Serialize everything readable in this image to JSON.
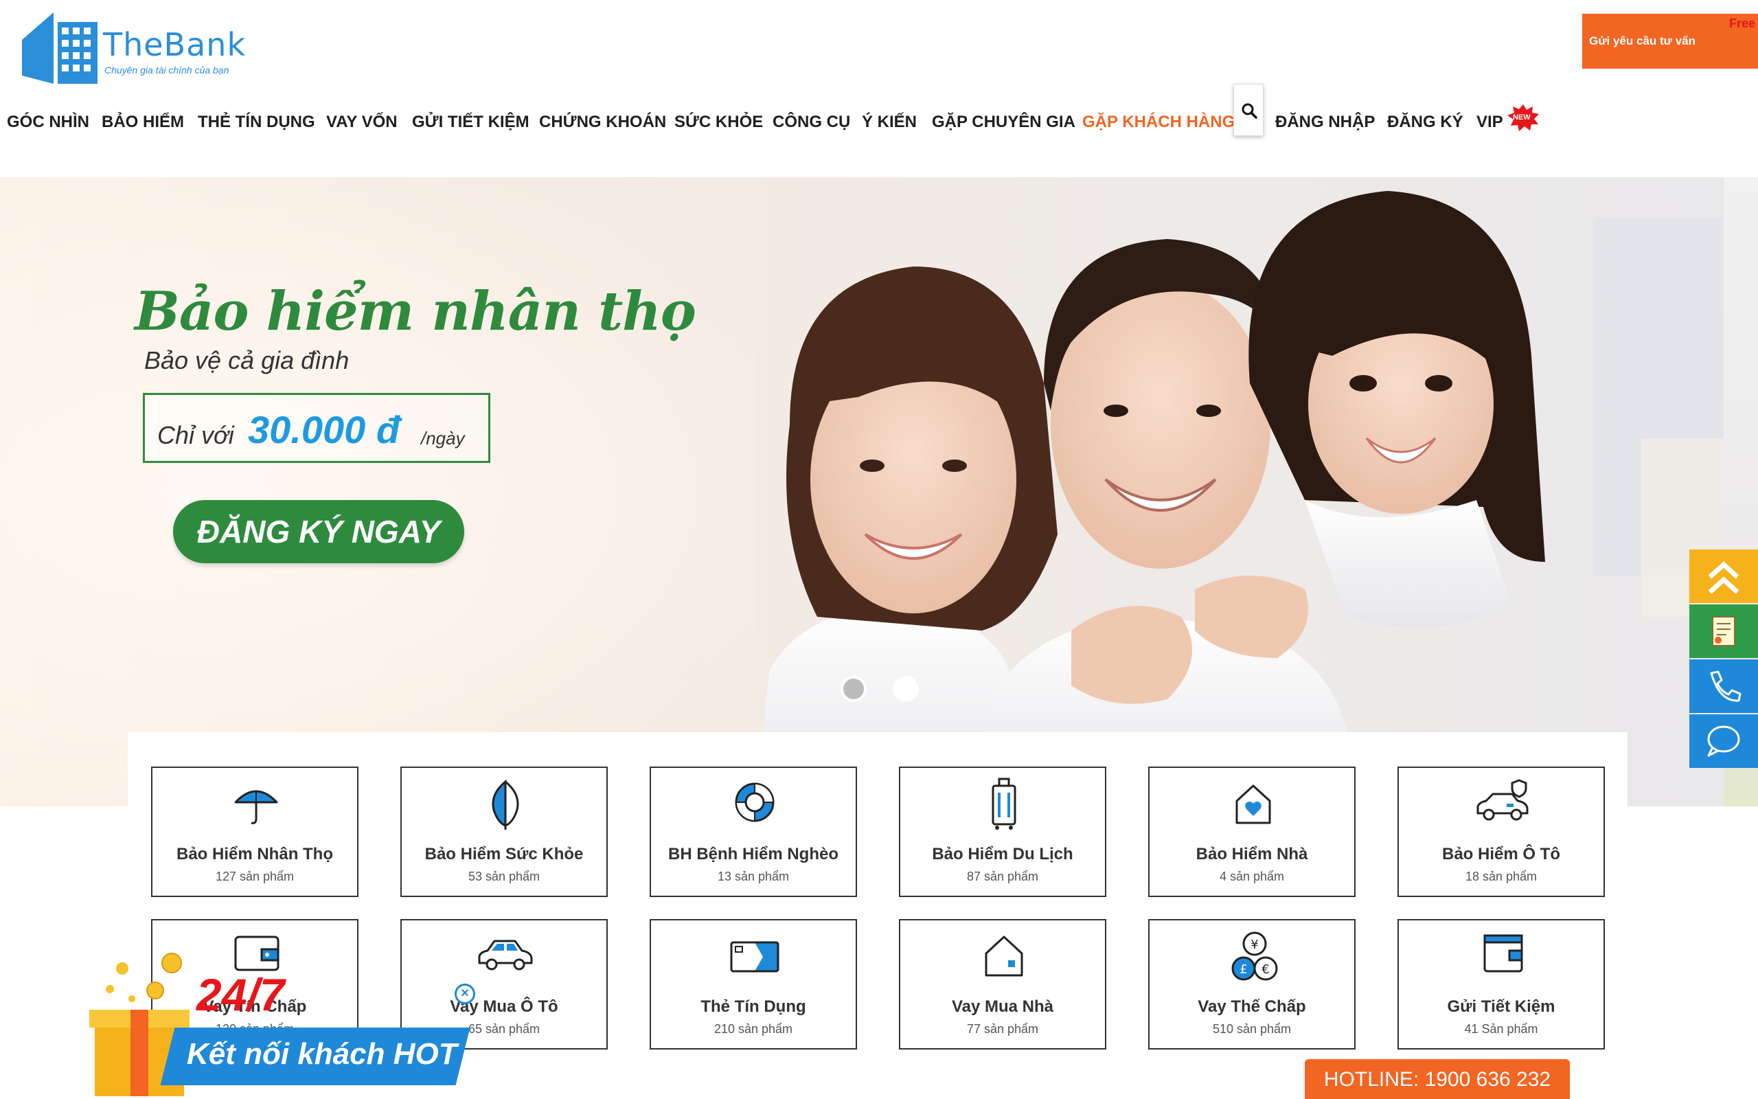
{
  "header": {
    "logo_text": "TheBank",
    "logo_tagline": "Chuyên gia tài chính của bạn",
    "consult_label": "Gửi yêu cầu tư vấn",
    "consult_badge": "Free"
  },
  "nav": {
    "items": [
      "GÓC NHÌN",
      "BẢO HIỂM",
      "THẺ TÍN DỤNG",
      "VAY VỐN",
      "GỬI TIẾT KIỆM",
      "CHỨNG KHOÁN",
      "SỨC KHỎE",
      "CÔNG CỤ",
      "Ý KIẾN",
      "GẶP CHUYÊN GIA",
      "GẶP KHÁCH HÀNG",
      "ĐĂNG NHẬP",
      "ĐĂNG KÝ",
      "VIP"
    ],
    "active_item": "GẶP KHÁCH HÀNG",
    "new_badge": "NEW"
  },
  "hero": {
    "headline": "Bảo hiểm nhân thọ",
    "subline": "Bảo vệ cả gia đình",
    "price_prefix": "Chỉ với",
    "price_amount": "30.000 đ",
    "price_unit": "/ngày",
    "cta": "ĐĂNG KÝ NGAY",
    "slides_count": 2,
    "active_slide": 1
  },
  "categories": [
    {
      "title": "Bảo Hiểm Nhân Thọ",
      "count": "127 sản phẩm",
      "icon": "umbrella-icon"
    },
    {
      "title": "Bảo Hiểm Sức Khỏe",
      "count": "53 sản phẩm",
      "icon": "leaf-icon"
    },
    {
      "title": "BH Bệnh Hiểm Nghèo",
      "count": "13 sản phẩm",
      "icon": "lifebuoy-icon"
    },
    {
      "title": "Bảo Hiểm Du Lịch",
      "count": "87 sản phẩm",
      "icon": "luggage-icon"
    },
    {
      "title": "Bảo Hiểm Nhà",
      "count": "4 sản phẩm",
      "icon": "house-heart-icon"
    },
    {
      "title": "Bảo Hiểm Ô Tô",
      "count": "18 sản phẩm",
      "icon": "car-shield-icon"
    },
    {
      "title": "Vay Tín Chấp",
      "count": "120 sản phẩm",
      "icon": "wallet-icon"
    },
    {
      "title": "Vay Mua Ô Tô",
      "count": "65 sản phẩm",
      "icon": "car-icon"
    },
    {
      "title": "Thẻ Tín Dụng",
      "count": "210 sản phẩm",
      "icon": "credit-card-icon"
    },
    {
      "title": "Vay Mua Nhà",
      "count": "77 sản phẩm",
      "icon": "house-icon"
    },
    {
      "title": "Vay Thế Chấp",
      "count": "510 sản phẩm",
      "icon": "currency-coins-icon"
    },
    {
      "title": "Gửi Tiết Kiệm",
      "count": "41 Sản phẩm",
      "icon": "savings-wallet-icon"
    }
  ],
  "promo": {
    "badge": "24/7",
    "text": "Kết nối khách HOT",
    "close": "×"
  },
  "hotline": "HOTLINE: 1900 636 232",
  "side_bar": [
    "scroll-top-icon",
    "document-icon",
    "phone-icon",
    "chat-icon"
  ],
  "colors": {
    "brand_blue": "#2a8ed8",
    "accent_orange": "#f26522",
    "hero_green": "#2e8b3e",
    "price_blue": "#1e9be0",
    "side_yellow": "#f6b21b",
    "side_green": "#2e9b48",
    "side_blue": "#1e89d8"
  }
}
